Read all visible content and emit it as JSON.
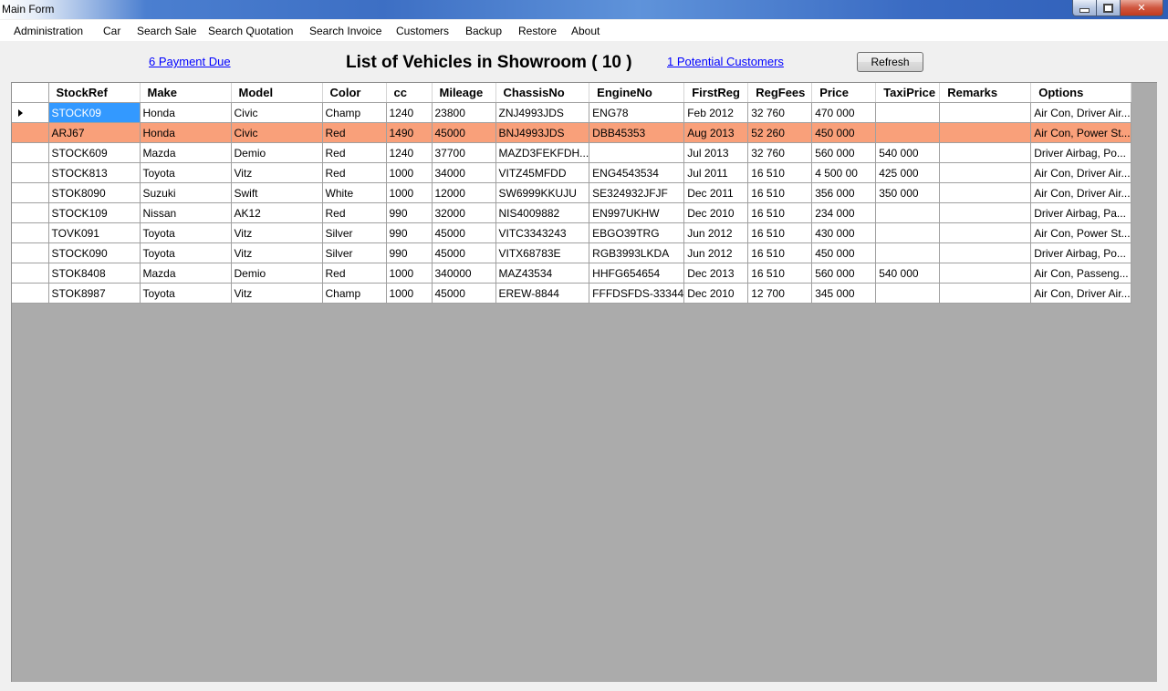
{
  "window": {
    "title": "Main Form"
  },
  "menu": [
    "Administration",
    "Car",
    "Search Sale",
    "Search Quotation",
    "Search Invoice",
    "Customers",
    "Backup",
    "Restore",
    "About"
  ],
  "header": {
    "payment_due_link": "6 Payment Due",
    "heading": "List of Vehicles in Showroom ( 10 )",
    "potential_customers_link": "1 Potential Customers",
    "refresh_label": "Refresh"
  },
  "colors": {
    "highlight_row": "#f9a07a",
    "selected_cell": "#3399ff",
    "link": "#0000ff"
  },
  "grid": {
    "columns": [
      "StockRef",
      "Make",
      "Model",
      "Color",
      "cc",
      "Mileage",
      "ChassisNo",
      "EngineNo",
      "FirstReg",
      "RegFees",
      "Price",
      "TaxiPrice",
      "Remarks",
      "Options"
    ],
    "rows": [
      [
        "STOCK09",
        "Honda",
        "Civic",
        "Champ",
        "1240",
        "23800",
        "ZNJ4993JDS",
        "ENG78",
        "Feb 2012",
        "32 760",
        "470 000",
        "",
        "",
        "Air Con, Driver Air..."
      ],
      [
        "ARJ67",
        "Honda",
        "Civic",
        "Red",
        "1490",
        "45000",
        "BNJ4993JDS",
        "DBB45353",
        "Aug 2013",
        "52 260",
        "450 000",
        "",
        "",
        "Air Con, Power St..."
      ],
      [
        "STOCK609",
        "Mazda",
        "Demio",
        "Red",
        "1240",
        "37700",
        "MAZD3FEKFDH...",
        "",
        "Jul 2013",
        "32 760",
        "560 000",
        "540 000",
        "",
        "Driver Airbag, Po..."
      ],
      [
        "STOCK813",
        "Toyota",
        "Vitz",
        "Red",
        "1000",
        " 34000",
        "VITZ45MFDD",
        "ENG4543534",
        "Jul 2011",
        "16 510",
        "4 500 00",
        "425 000",
        "",
        "Air Con, Driver Air..."
      ],
      [
        "STOK8090",
        "Suzuki",
        "Swift",
        "White",
        "1000",
        "12000",
        "SW6999KKUJU",
        "SE324932JFJF",
        "Dec 2011",
        "16 510",
        "356 000",
        "350 000",
        "",
        "Air Con, Driver Air..."
      ],
      [
        "STOCK109",
        "Nissan",
        "AK12",
        "Red",
        "990",
        "32000",
        "NIS4009882",
        "EN997UKHW",
        "Dec 2010",
        "16 510",
        "234 000",
        "",
        "",
        "Driver Airbag, Pa..."
      ],
      [
        "TOVK091",
        "Toyota",
        "Vitz",
        "Silver",
        "990",
        " 45000",
        "VITC3343243",
        "EBGO39TRG",
        "Jun 2012",
        "16 510",
        "430 000",
        "",
        "",
        "Air Con, Power St..."
      ],
      [
        "STOCK090",
        "Toyota",
        "Vitz",
        "Silver",
        "990",
        "45000",
        "VITX68783E",
        "RGB3993LKDA",
        "Jun 2012",
        "16 510",
        "450 000",
        "",
        "",
        "Driver Airbag, Po..."
      ],
      [
        "STOK8408",
        "Mazda",
        "Demio",
        "Red",
        "1000",
        "340000",
        "MAZ43534",
        "HHFG654654",
        "Dec 2013",
        "16 510",
        "560 000",
        "540 000",
        "",
        "Air Con, Passeng..."
      ],
      [
        "STOK8987",
        "Toyota",
        "Vitz",
        "Champ",
        "1000",
        "45000",
        "EREW-8844",
        "FFFDSFDS-33344",
        "Dec 2010",
        "12 700",
        "345 000",
        "",
        "",
        "Air Con, Driver Air..."
      ]
    ]
  }
}
